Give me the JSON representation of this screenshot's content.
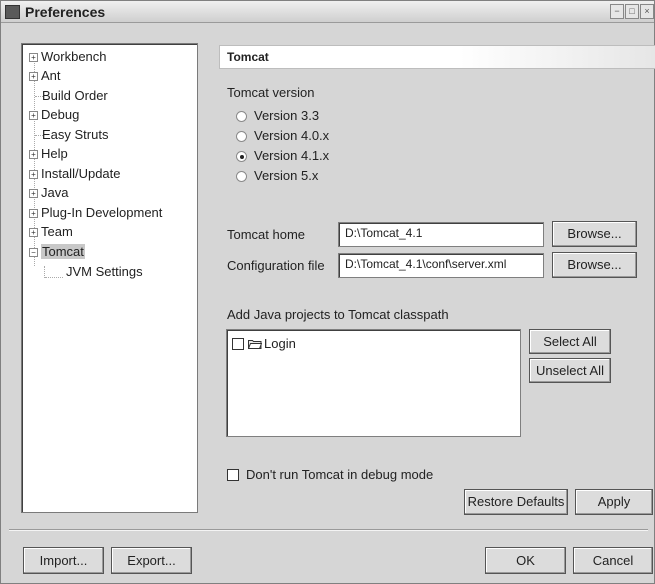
{
  "window": {
    "title": "Preferences"
  },
  "tree": {
    "items": [
      {
        "label": "Workbench",
        "expandable": true
      },
      {
        "label": "Ant",
        "expandable": true
      },
      {
        "label": "Build Order",
        "expandable": false
      },
      {
        "label": "Debug",
        "expandable": true
      },
      {
        "label": "Easy Struts",
        "expandable": false
      },
      {
        "label": "Help",
        "expandable": true
      },
      {
        "label": "Install/Update",
        "expandable": true
      },
      {
        "label": "Java",
        "expandable": true
      },
      {
        "label": "Plug-In Development",
        "expandable": true
      },
      {
        "label": "Team",
        "expandable": true
      },
      {
        "label": "Tomcat",
        "expandable": true,
        "expanded": true,
        "selected": true
      },
      {
        "label": "JVM Settings",
        "child": true
      }
    ]
  },
  "page": {
    "title": "Tomcat",
    "version_group_label": "Tomcat version",
    "versions": [
      {
        "label": "Version 3.3",
        "selected": false
      },
      {
        "label": "Version 4.0.x",
        "selected": false
      },
      {
        "label": "Version 4.1.x",
        "selected": true
      },
      {
        "label": "Version 5.x",
        "selected": false
      }
    ],
    "home_label": "Tomcat home",
    "home_value": "D:\\Tomcat_4.1",
    "config_label": "Configuration file",
    "config_value": "D:\\Tomcat_4.1\\conf\\server.xml",
    "browse_label": "Browse...",
    "projects_label": "Add Java projects to Tomcat classpath",
    "projects": [
      {
        "label": "Login",
        "checked": false
      }
    ],
    "select_all": "Select All",
    "unselect_all": "Unselect All",
    "debug_label": "Don't run Tomcat in debug mode",
    "restore_defaults": "Restore Defaults",
    "apply": "Apply"
  },
  "footer": {
    "import": "Import...",
    "export": "Export...",
    "ok": "OK",
    "cancel": "Cancel"
  }
}
